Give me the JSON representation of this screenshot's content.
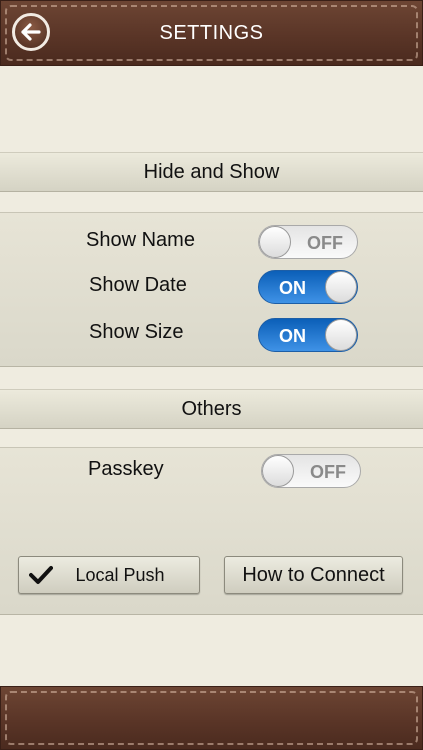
{
  "header": {
    "title": "SETTINGS"
  },
  "icons": {
    "back": "back-arrow-icon",
    "check": "checkmark-icon"
  },
  "colors": {
    "leather": "#5a3527",
    "toggle_on": "#1e6fcf",
    "background": "#efece0"
  },
  "sections": {
    "hide_show": {
      "title": "Hide and Show",
      "rows": [
        {
          "label": "Show Name",
          "state": "OFF"
        },
        {
          "label": "Show Date",
          "state": "ON"
        },
        {
          "label": "Show Size",
          "state": "ON"
        }
      ]
    },
    "others": {
      "title": "Others",
      "rows": [
        {
          "label": "Passkey",
          "state": "OFF"
        }
      ],
      "buttons": {
        "local_push": "Local Push",
        "how_to_connect": "How to Connect"
      }
    }
  }
}
